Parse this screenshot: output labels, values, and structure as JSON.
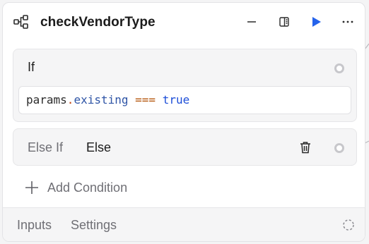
{
  "node": {
    "title": "checkVendorType",
    "icon": "workflow-branch-icon"
  },
  "header_actions": [
    {
      "name": "minimize-icon"
    },
    {
      "name": "side-panel-icon"
    },
    {
      "name": "run-icon",
      "color": "#2563eb"
    },
    {
      "name": "more-options-icon"
    }
  ],
  "if_block": {
    "label": "If",
    "expression": {
      "object": "params",
      "dot": ".",
      "property": "existing",
      "operator": "===",
      "value": "true"
    }
  },
  "else_block": {
    "type_label": "Else If",
    "name": "Else"
  },
  "add_condition": {
    "label": "Add Condition"
  },
  "footer": {
    "tabs": [
      "Inputs",
      "Settings"
    ]
  },
  "colors": {
    "accent": "#2563eb",
    "panel_bg": "#ffffff",
    "block_bg": "#f5f5f6"
  }
}
